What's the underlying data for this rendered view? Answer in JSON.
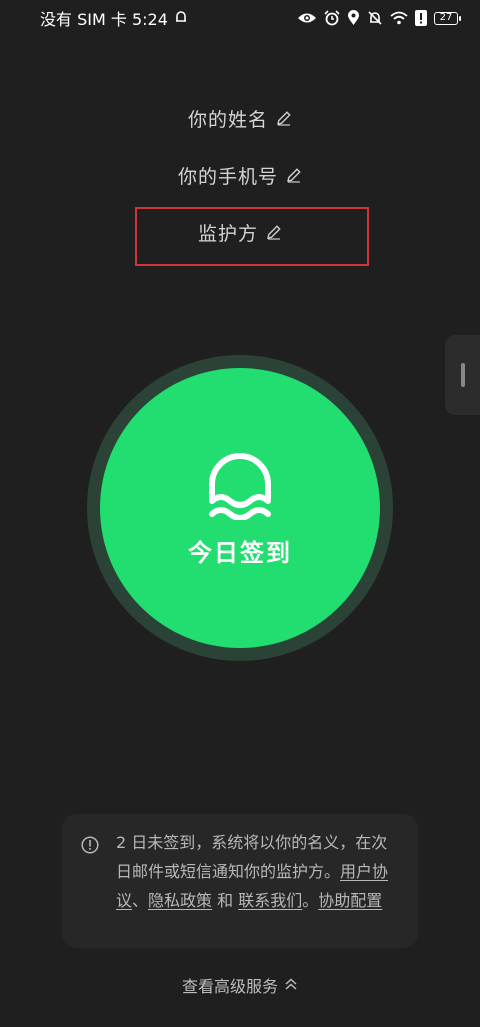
{
  "status_bar": {
    "carrier_time": "没有 SIM 卡 5:24",
    "battery_level": "27"
  },
  "profile": {
    "name_label": "你的姓名",
    "phone_label": "你的手机号",
    "guardian_label": "监护方"
  },
  "checkin": {
    "button_label": "今日签到",
    "accent_color": "#22dd6f"
  },
  "notice": {
    "text": "2 日未签到，系统将以你的名义，在次日邮件或短信通知你的监护方。",
    "user_agreement_link": "用户协议",
    "separator": "、",
    "privacy_policy_link": "隐私政策",
    "and_text": " 和 ",
    "contact_us_link": "联系我们",
    "period": "。",
    "help_config_link": "协助配置"
  },
  "footer": {
    "advanced_services_label": "查看高级服务"
  }
}
